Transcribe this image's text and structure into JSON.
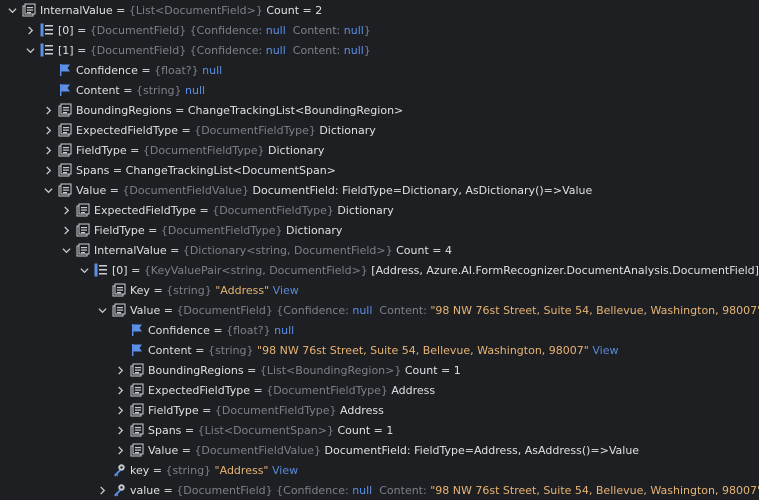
{
  "colors": {
    "background": "#1e1f22",
    "text": "#dfe1e5",
    "type_hint": "#7b808a",
    "null_keyword": "#5b8fe8",
    "string_value": "#e7b474",
    "link": "#5a8ad6",
    "icon_blue": "#5b8fe8"
  },
  "rows": [
    {
      "level": 0,
      "chevron": "expanded",
      "icon": "object-icon",
      "parts": [
        {
          "c": "name",
          "t": "InternalValue"
        },
        {
          "c": "op",
          "t": " = "
        },
        {
          "c": "type",
          "t": "{List<DocumentField>}"
        },
        {
          "c": "plain",
          "t": " Count = 2"
        }
      ]
    },
    {
      "level": 1,
      "chevron": "collapsed",
      "icon": "list-icon",
      "parts": [
        {
          "c": "name",
          "t": "[0]"
        },
        {
          "c": "op",
          "t": " = "
        },
        {
          "c": "type",
          "t": "{DocumentField}"
        },
        {
          "c": "type",
          "t": " {Confidence: "
        },
        {
          "c": "null",
          "t": "null"
        },
        {
          "c": "type",
          "t": "  Content: "
        },
        {
          "c": "null",
          "t": "null"
        },
        {
          "c": "type",
          "t": "}"
        }
      ]
    },
    {
      "level": 1,
      "chevron": "expanded",
      "icon": "list-icon",
      "parts": [
        {
          "c": "name",
          "t": "[1]"
        },
        {
          "c": "op",
          "t": " = "
        },
        {
          "c": "type",
          "t": "{DocumentField}"
        },
        {
          "c": "type",
          "t": " {Confidence: "
        },
        {
          "c": "null",
          "t": "null"
        },
        {
          "c": "type",
          "t": "  Content: "
        },
        {
          "c": "null",
          "t": "null"
        },
        {
          "c": "type",
          "t": "}"
        }
      ]
    },
    {
      "level": 2,
      "chevron": "none",
      "icon": "flag-icon",
      "parts": [
        {
          "c": "name",
          "t": "Confidence"
        },
        {
          "c": "op",
          "t": " = "
        },
        {
          "c": "type",
          "t": "{float?}"
        },
        {
          "c": "null",
          "t": " null"
        }
      ]
    },
    {
      "level": 2,
      "chevron": "none",
      "icon": "flag-icon",
      "parts": [
        {
          "c": "name",
          "t": "Content"
        },
        {
          "c": "op",
          "t": " = "
        },
        {
          "c": "type",
          "t": "{string}"
        },
        {
          "c": "null",
          "t": " null"
        }
      ]
    },
    {
      "level": 2,
      "chevron": "collapsed",
      "icon": "object-icon",
      "parts": [
        {
          "c": "name",
          "t": "BoundingRegions"
        },
        {
          "c": "op",
          "t": " = "
        },
        {
          "c": "plain",
          "t": "ChangeTrackingList<BoundingRegion>"
        }
      ]
    },
    {
      "level": 2,
      "chevron": "collapsed",
      "icon": "object-icon",
      "parts": [
        {
          "c": "name",
          "t": "ExpectedFieldType"
        },
        {
          "c": "op",
          "t": " = "
        },
        {
          "c": "type",
          "t": "{DocumentFieldType}"
        },
        {
          "c": "plain",
          "t": " Dictionary"
        }
      ]
    },
    {
      "level": 2,
      "chevron": "collapsed",
      "icon": "object-icon",
      "parts": [
        {
          "c": "name",
          "t": "FieldType"
        },
        {
          "c": "op",
          "t": " = "
        },
        {
          "c": "type",
          "t": "{DocumentFieldType}"
        },
        {
          "c": "plain",
          "t": " Dictionary"
        }
      ]
    },
    {
      "level": 2,
      "chevron": "collapsed",
      "icon": "object-icon",
      "parts": [
        {
          "c": "name",
          "t": "Spans"
        },
        {
          "c": "op",
          "t": " = "
        },
        {
          "c": "plain",
          "t": "ChangeTrackingList<DocumentSpan>"
        }
      ]
    },
    {
      "level": 2,
      "chevron": "expanded",
      "icon": "object-icon",
      "parts": [
        {
          "c": "name",
          "t": "Value"
        },
        {
          "c": "op",
          "t": " = "
        },
        {
          "c": "type",
          "t": "{DocumentFieldValue}"
        },
        {
          "c": "plain",
          "t": " DocumentField: FieldType=Dictionary, AsDictionary()=>Value"
        }
      ]
    },
    {
      "level": 3,
      "chevron": "collapsed",
      "icon": "object-icon",
      "parts": [
        {
          "c": "name",
          "t": "ExpectedFieldType"
        },
        {
          "c": "op",
          "t": " = "
        },
        {
          "c": "type",
          "t": "{DocumentFieldType}"
        },
        {
          "c": "plain",
          "t": " Dictionary"
        }
      ]
    },
    {
      "level": 3,
      "chevron": "collapsed",
      "icon": "object-icon",
      "parts": [
        {
          "c": "name",
          "t": "FieldType"
        },
        {
          "c": "op",
          "t": " = "
        },
        {
          "c": "type",
          "t": "{DocumentFieldType}"
        },
        {
          "c": "plain",
          "t": " Dictionary"
        }
      ]
    },
    {
      "level": 3,
      "chevron": "expanded",
      "icon": "object-icon",
      "parts": [
        {
          "c": "name",
          "t": "InternalValue"
        },
        {
          "c": "op",
          "t": " = "
        },
        {
          "c": "type",
          "t": "{Dictionary<string, DocumentField>}"
        },
        {
          "c": "plain",
          "t": " Count = 4"
        }
      ]
    },
    {
      "level": 4,
      "chevron": "expanded",
      "icon": "list-icon",
      "parts": [
        {
          "c": "name",
          "t": "[0]"
        },
        {
          "c": "op",
          "t": " = "
        },
        {
          "c": "type",
          "t": "{KeyValuePair<string, DocumentField>}"
        },
        {
          "c": "plain",
          "t": " [Address, Azure.AI.FormRecognizer.DocumentAnalysis.DocumentField]"
        }
      ]
    },
    {
      "level": 5,
      "chevron": "none",
      "icon": "object-icon",
      "parts": [
        {
          "c": "name",
          "t": "Key"
        },
        {
          "c": "op",
          "t": " = "
        },
        {
          "c": "type",
          "t": "{string}"
        },
        {
          "c": "str",
          "t": " \"Address\""
        },
        {
          "c": "link",
          "t": " View"
        }
      ]
    },
    {
      "level": 5,
      "chevron": "expanded",
      "icon": "object-icon",
      "parts": [
        {
          "c": "name",
          "t": "Value"
        },
        {
          "c": "op",
          "t": " = "
        },
        {
          "c": "type",
          "t": "{DocumentField}"
        },
        {
          "c": "type",
          "t": " {Confidence: "
        },
        {
          "c": "null",
          "t": "null"
        },
        {
          "c": "type",
          "t": "  Content: "
        },
        {
          "c": "str",
          "t": "\"98 NW 76st Street, Suite 54, Bellevue, Washington, 98007\""
        },
        {
          "c": "type",
          "t": "}"
        }
      ]
    },
    {
      "level": 6,
      "chevron": "none",
      "icon": "flag-icon",
      "parts": [
        {
          "c": "name",
          "t": "Confidence"
        },
        {
          "c": "op",
          "t": " = "
        },
        {
          "c": "type",
          "t": "{float?}"
        },
        {
          "c": "null",
          "t": " null"
        }
      ]
    },
    {
      "level": 6,
      "chevron": "none",
      "icon": "flag-icon",
      "parts": [
        {
          "c": "name",
          "t": "Content"
        },
        {
          "c": "op",
          "t": " = "
        },
        {
          "c": "type",
          "t": "{string}"
        },
        {
          "c": "str",
          "t": " \"98 NW 76st Street, Suite 54, Bellevue, Washington, 98007\""
        },
        {
          "c": "link",
          "t": " View"
        }
      ]
    },
    {
      "level": 6,
      "chevron": "collapsed",
      "icon": "object-icon",
      "parts": [
        {
          "c": "name",
          "t": "BoundingRegions"
        },
        {
          "c": "op",
          "t": " = "
        },
        {
          "c": "type",
          "t": "{List<BoundingRegion>}"
        },
        {
          "c": "plain",
          "t": " Count = 1"
        }
      ]
    },
    {
      "level": 6,
      "chevron": "collapsed",
      "icon": "object-icon",
      "parts": [
        {
          "c": "name",
          "t": "ExpectedFieldType"
        },
        {
          "c": "op",
          "t": " = "
        },
        {
          "c": "type",
          "t": "{DocumentFieldType}"
        },
        {
          "c": "plain",
          "t": " Address"
        }
      ]
    },
    {
      "level": 6,
      "chevron": "collapsed",
      "icon": "object-icon",
      "parts": [
        {
          "c": "name",
          "t": "FieldType"
        },
        {
          "c": "op",
          "t": " = "
        },
        {
          "c": "type",
          "t": "{DocumentFieldType}"
        },
        {
          "c": "plain",
          "t": " Address"
        }
      ]
    },
    {
      "level": 6,
      "chevron": "collapsed",
      "icon": "object-icon",
      "parts": [
        {
          "c": "name",
          "t": "Spans"
        },
        {
          "c": "op",
          "t": " = "
        },
        {
          "c": "type",
          "t": "{List<DocumentSpan>}"
        },
        {
          "c": "plain",
          "t": " Count = 1"
        }
      ]
    },
    {
      "level": 6,
      "chevron": "collapsed",
      "icon": "object-icon",
      "parts": [
        {
          "c": "name",
          "t": "Value"
        },
        {
          "c": "op",
          "t": " = "
        },
        {
          "c": "type",
          "t": "{DocumentFieldValue}"
        },
        {
          "c": "plain",
          "t": " DocumentField: FieldType=Address, AsAddress()=>Value"
        }
      ]
    },
    {
      "level": 5,
      "chevron": "none",
      "icon": "key-icon",
      "parts": [
        {
          "c": "name",
          "t": "key"
        },
        {
          "c": "op",
          "t": " = "
        },
        {
          "c": "type",
          "t": "{string}"
        },
        {
          "c": "str",
          "t": " \"Address\""
        },
        {
          "c": "link",
          "t": " View"
        }
      ]
    },
    {
      "level": 5,
      "chevron": "collapsed",
      "icon": "key-icon",
      "parts": [
        {
          "c": "name",
          "t": "value"
        },
        {
          "c": "op",
          "t": " = "
        },
        {
          "c": "type",
          "t": "{DocumentField}"
        },
        {
          "c": "type",
          "t": " {Confidence: "
        },
        {
          "c": "null",
          "t": "null"
        },
        {
          "c": "type",
          "t": "  Content: "
        },
        {
          "c": "str",
          "t": "\"98 NW 76st Street, Suite 54, Bellevue, Washington, 98007\""
        },
        {
          "c": "type",
          "t": "}"
        }
      ]
    }
  ]
}
